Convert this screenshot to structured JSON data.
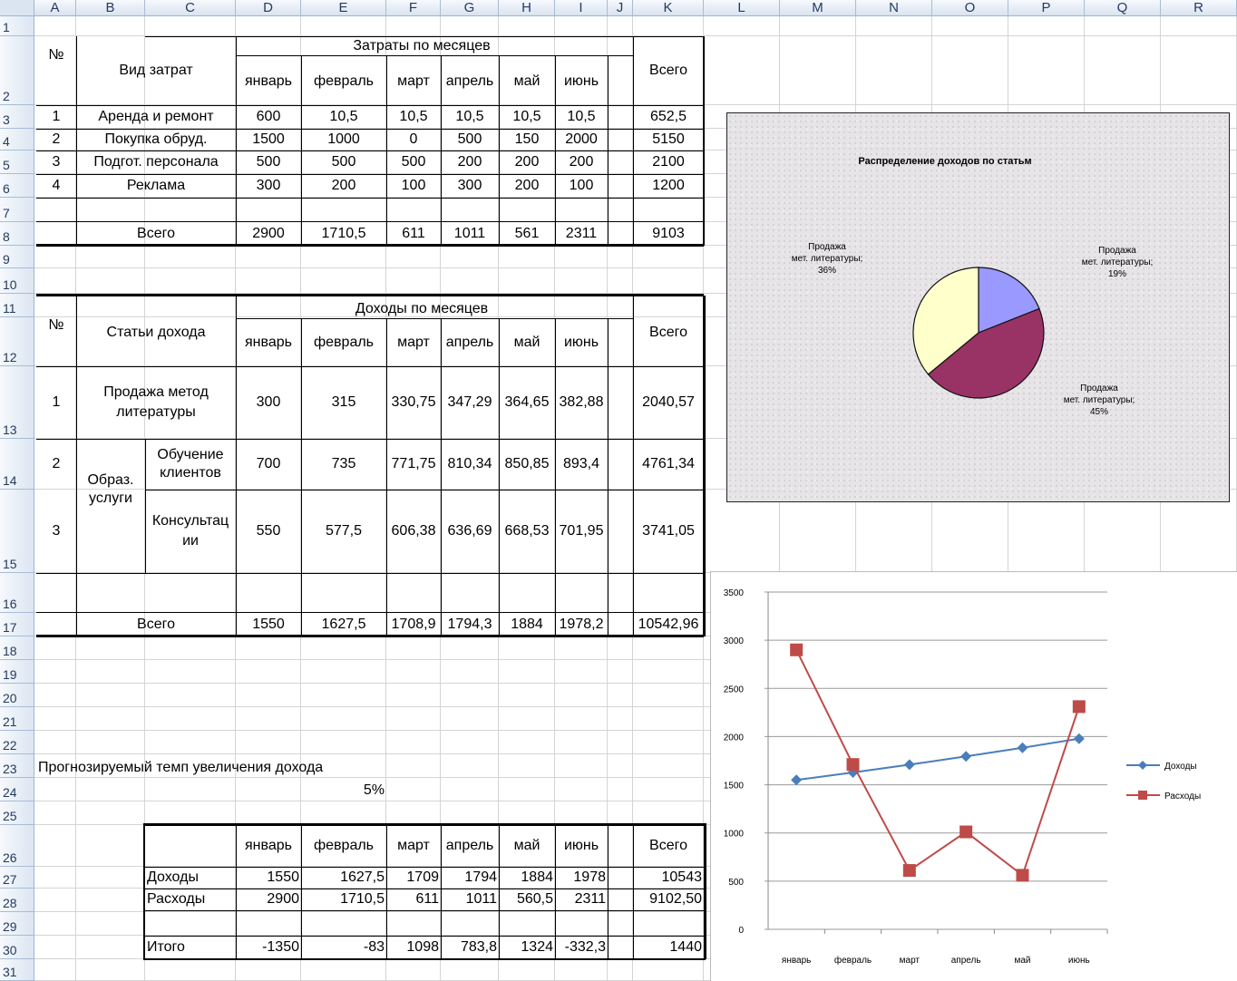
{
  "columns": [
    "A",
    "B",
    "C",
    "D",
    "E",
    "F",
    "G",
    "H",
    "I",
    "J",
    "K",
    "L",
    "M",
    "N",
    "O",
    "P",
    "Q",
    "R"
  ],
  "rows": [
    "1",
    "2",
    "3",
    "4",
    "5",
    "6",
    "7",
    "8",
    "9",
    "10",
    "11",
    "12",
    "13",
    "14",
    "15",
    "16",
    "17",
    "18",
    "19",
    "20",
    "21",
    "22",
    "23",
    "24",
    "25",
    "26",
    "27",
    "28",
    "29",
    "30",
    "31"
  ],
  "expenses": {
    "num_header": "№",
    "type_header": "Вид затрат",
    "group_header": "Затраты по месяцев",
    "months": [
      "январь",
      "февраль",
      "март",
      "апрель",
      "май",
      "июнь"
    ],
    "total_header": "Всего",
    "rows": [
      {
        "n": "1",
        "name": "Аренда и ремонт",
        "v": [
          "600",
          "10,5",
          "10,5",
          "10,5",
          "10,5",
          "10,5"
        ],
        "total": "652,5"
      },
      {
        "n": "2",
        "name": "Покупка обруд.",
        "v": [
          "1500",
          "1000",
          "0",
          "500",
          "150",
          "2000"
        ],
        "total": "5150"
      },
      {
        "n": "3",
        "name": "Подгот. персонала",
        "v": [
          "500",
          "500",
          "500",
          "200",
          "200",
          "200"
        ],
        "total": "2100"
      },
      {
        "n": "4",
        "name": "Реклама",
        "v": [
          "300",
          "200",
          "100",
          "300",
          "200",
          "100"
        ],
        "total": "1200"
      }
    ],
    "sum_label": "Всего",
    "sum": [
      "2900",
      "1710,5",
      "611",
      "1011",
      "561",
      "2311"
    ],
    "sum_total": "9103"
  },
  "income": {
    "num_header": "№",
    "type_header": "Статьи дохода",
    "group_header": "Доходы по месяцев",
    "months": [
      "январь",
      "февраль",
      "март",
      "апрель",
      "май",
      "июнь"
    ],
    "total_header": "Всего",
    "r1": {
      "n": "1",
      "name": "Продажа метод литературы",
      "v": [
        "300",
        "315",
        "330,75",
        "347,29",
        "364,65",
        "382,88"
      ],
      "total": "2040,57"
    },
    "services_label": "Образ. услуги",
    "r2": {
      "n": "2",
      "name": "Обучение клиентов",
      "v": [
        "700",
        "735",
        "771,75",
        "810,34",
        "850,85",
        "893,4"
      ],
      "total": "4761,34"
    },
    "r3": {
      "n": "3",
      "name": "Консультац ии",
      "v": [
        "550",
        "577,5",
        "606,38",
        "636,69",
        "668,53",
        "701,95"
      ],
      "total": "3741,05"
    },
    "sum_label": "Всего",
    "sum": [
      "1550",
      "1627,5",
      "1708,9",
      "1794,3",
      "1884",
      "1978,2"
    ],
    "sum_total": "10542,96"
  },
  "forecast": {
    "label": "Прогнозируемый темп увеличения дохода",
    "value": "5%"
  },
  "summary": {
    "months": [
      "январь",
      "февраль",
      "март",
      "апрель",
      "май",
      "июнь"
    ],
    "total_header": "Всего",
    "income_label": "Доходы",
    "income": [
      "1550",
      "1627,5",
      "1709",
      "1794",
      "1884",
      "1978"
    ],
    "income_total": "10543",
    "expense_label": "Расходы",
    "expense": [
      "2900",
      "1710,5",
      "611",
      "1011",
      "560,5",
      "2311"
    ],
    "expense_total": "9102,50",
    "result_label": "Итого",
    "result": [
      "-1350",
      "-83",
      "1098",
      "783,8",
      "1324",
      "-332,3"
    ],
    "result_total": "1440"
  },
  "pie_chart": {
    "title": "Распределение доходов по статьм",
    "labels": [
      "Продажа мет. литературы; 19%",
      "Продажа мет. литературы; 45%",
      "Продажа мет. литературы; 36%"
    ]
  },
  "chart_data": [
    {
      "type": "pie",
      "title": "Распределение доходов по статьм",
      "slices": [
        {
          "label": "Продажа мет. литературы; 19%",
          "value": 19,
          "color": "#9999ff"
        },
        {
          "label": "Продажа мет. литературы; 45%",
          "value": 45,
          "color": "#993366"
        },
        {
          "label": "Продажа мет. литературы; 36%",
          "value": 36,
          "color": "#ffffcc"
        }
      ]
    },
    {
      "type": "line",
      "categories": [
        "январь",
        "февраль",
        "март",
        "апрель",
        "май",
        "июнь"
      ],
      "yticks": [
        "0",
        "500",
        "1000",
        "1500",
        "2000",
        "2500",
        "3000",
        "3500"
      ],
      "ylim": [
        0,
        3500
      ],
      "series": [
        {
          "name": "Доходы",
          "values": [
            1550,
            1627.5,
            1708.9,
            1794.3,
            1884,
            1978.2
          ],
          "color": "#4a7ebb",
          "marker": "diamond"
        },
        {
          "name": "Расходы",
          "values": [
            2900,
            1710.5,
            611,
            1011,
            561,
            2311
          ],
          "color": "#be4b48",
          "marker": "square"
        }
      ],
      "legend": "right",
      "grid": true
    }
  ]
}
